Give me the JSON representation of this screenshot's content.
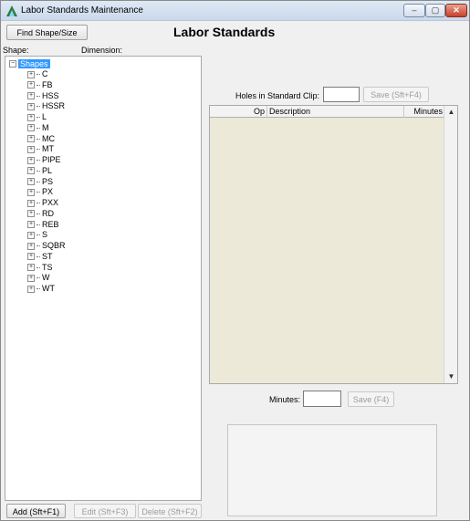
{
  "window": {
    "title": "Labor Standards Maintenance",
    "controls": {
      "minimize": "–",
      "maximize": "▢",
      "close": "✕"
    }
  },
  "toolbar": {
    "find_button": "Find Shape/Size",
    "page_title": "Labor Standards"
  },
  "tree": {
    "shape_label": "Shape:",
    "dimension_label": "Dimension:",
    "root": {
      "toggle": "−",
      "label": "Shapes"
    },
    "items": [
      "C",
      "FB",
      "HSS",
      "HSSR",
      "L",
      "M",
      "MC",
      "MT",
      "PIPE",
      "PL",
      "PS",
      "PX",
      "PXX",
      "RD",
      "REB",
      "S",
      "SQBR",
      "ST",
      "TS",
      "W",
      "WT"
    ],
    "item_toggle": "+"
  },
  "actions": {
    "add": "Add (Sft+F1)",
    "edit": "Edit (Sft+F3)",
    "delete": "Delete (Sft+F2)"
  },
  "holes": {
    "label": "Holes in Standard Clip:",
    "value": "",
    "save_button": "Save (Sft+F4)"
  },
  "grid": {
    "columns": {
      "op": "Op",
      "description": "Description",
      "minutes": "Minutes"
    },
    "rows": [],
    "scroll_up": "▲",
    "scroll_down": "▼"
  },
  "minutes": {
    "label": "Minutes:",
    "value": "",
    "save_button": "Save (F4)"
  }
}
